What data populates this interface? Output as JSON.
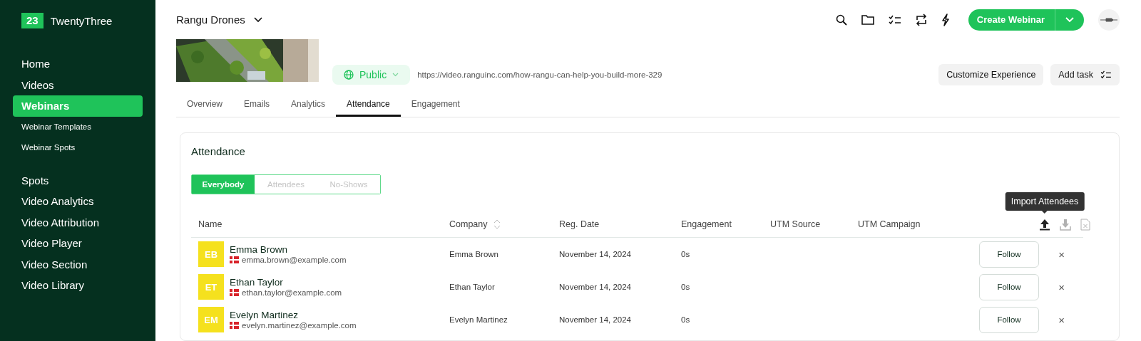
{
  "brand": {
    "badge": "23",
    "name": "TwentyThree"
  },
  "sidebar": {
    "items": [
      {
        "label": "Home",
        "kind": "main",
        "selected": false
      },
      {
        "label": "Videos",
        "kind": "main",
        "selected": false
      },
      {
        "label": "Webinars",
        "kind": "main",
        "selected": true
      },
      {
        "label": "Webinar Templates",
        "kind": "sub",
        "selected": false
      },
      {
        "label": "Webinar Spots",
        "kind": "sub",
        "selected": false
      },
      {
        "label": "Spots",
        "kind": "main",
        "selected": false
      },
      {
        "label": "Video Analytics",
        "kind": "main",
        "selected": false
      },
      {
        "label": "Video Attribution",
        "kind": "main",
        "selected": false
      },
      {
        "label": "Video Player",
        "kind": "main",
        "selected": false
      },
      {
        "label": "Video Section",
        "kind": "main",
        "selected": false
      },
      {
        "label": "Video Library",
        "kind": "main",
        "selected": false
      }
    ]
  },
  "topbar": {
    "workspace": "Rangu Drones",
    "create_button": "Create Webinar"
  },
  "webinar": {
    "visibility": "Public",
    "url": "https://video.ranguinc.com/how-rangu-can-help-you-build-more-329",
    "buttons": [
      "Customize Experience",
      "Add task"
    ]
  },
  "tabs": [
    {
      "label": "Overview",
      "selected": false
    },
    {
      "label": "Emails",
      "selected": false
    },
    {
      "label": "Analytics",
      "selected": false
    },
    {
      "label": "Attendance",
      "selected": true
    },
    {
      "label": "Engagement",
      "selected": false
    }
  ],
  "attendance": {
    "title": "Attendance",
    "filters": [
      {
        "label": "Everybody",
        "selected": true
      },
      {
        "label": "Attendees",
        "selected": false
      },
      {
        "label": "No-Shows",
        "selected": false
      }
    ],
    "columns": [
      "Name",
      "Company",
      "Reg. Date",
      "Engagement",
      "UTM Source",
      "UTM Campaign"
    ],
    "actions": [
      {
        "kind": "import",
        "disabled": false
      },
      {
        "kind": "export",
        "disabled": true
      },
      {
        "kind": "excel",
        "disabled": true
      }
    ],
    "tooltip": "Import Attendees",
    "rows": [
      {
        "initials": "EB",
        "name": "Emma Brown",
        "email": "emma.brown@example.com",
        "company": "Emma Brown",
        "reg_date": "November 14, 2024",
        "engagement": "0s",
        "follow": "Follow",
        "remove": "×"
      },
      {
        "initials": "ET",
        "name": "Ethan Taylor",
        "email": "ethan.taylor@example.com",
        "company": "Ethan Taylor",
        "reg_date": "November 14, 2024",
        "engagement": "0s",
        "follow": "Follow",
        "remove": "×"
      },
      {
        "initials": "EM",
        "name": "Evelyn Martinez",
        "email": "evelyn.martinez@example.com",
        "company": "Evelyn Martinez",
        "reg_date": "November 14, 2024",
        "engagement": "0s",
        "follow": "Follow",
        "remove": "×"
      }
    ]
  }
}
